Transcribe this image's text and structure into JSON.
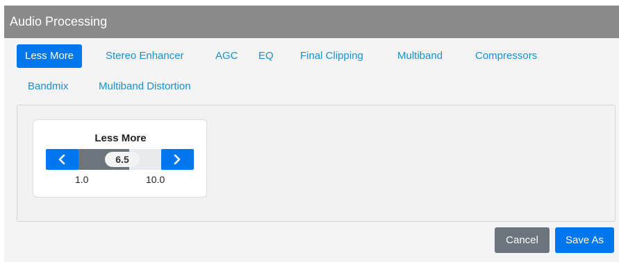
{
  "window": {
    "title": "Audio Processing"
  },
  "tabs": [
    {
      "label": "Less More",
      "active": true
    },
    {
      "label": "Stereo Enhancer",
      "active": false
    },
    {
      "label": "AGC",
      "active": false
    },
    {
      "label": "EQ",
      "active": false
    },
    {
      "label": "Final Clipping",
      "active": false
    },
    {
      "label": "Multiband",
      "active": false
    },
    {
      "label": "Compressors",
      "active": false
    },
    {
      "label": "Bandmix",
      "active": false
    },
    {
      "label": "Multiband Distortion",
      "active": false
    }
  ],
  "control": {
    "title": "Less More",
    "value": "6.5",
    "min": "1.0",
    "max": "10.0",
    "value_fraction": 0.61,
    "left_icon": "chevron-left-icon",
    "right_icon": "chevron-right-icon"
  },
  "footer": {
    "cancel_label": "Cancel",
    "save_label": "Save As"
  },
  "colors": {
    "accent": "#0077ee",
    "titlebar": "#8a8a8a",
    "tab_link": "#1a8fd0",
    "cancel": "#6c757d"
  }
}
